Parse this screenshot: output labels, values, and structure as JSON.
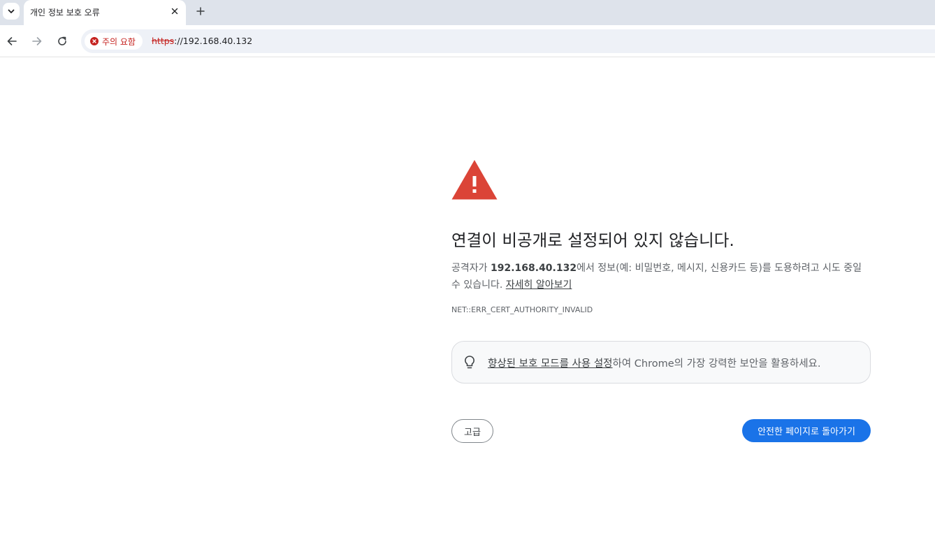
{
  "tab": {
    "title": "개인 정보 보호 오류"
  },
  "toolbar": {
    "security_chip_label": "주의 요함",
    "url_scheme": "https",
    "url_rest": "://192.168.40.132"
  },
  "interstitial": {
    "heading": "연결이 비공개로 설정되어 있지 않습니다.",
    "explanation_prefix": "공격자가 ",
    "host": "192.168.40.132",
    "explanation_suffix": "에서 정보(예: 비밀번호, 메시지, 신용카드 등)를 도용하려고 시도 중일 수 있습니다. ",
    "learn_more_link": "자세히 알아보기",
    "error_code": "NET::ERR_CERT_AUTHORITY_INVALID",
    "promo_link": "향상된 보호 모드를 사용 설정",
    "promo_suffix": "하여 Chrome의 가장 강력한 보안을 활용하세요.",
    "advanced_button": "고급",
    "back_button": "안전한 페이지로 돌아가기"
  },
  "colors": {
    "warning_red": "#db4437",
    "primary_blue": "#1a73e8",
    "danger_text": "#c5221f"
  },
  "icons": {
    "tab_search": "chevron-down-icon",
    "tab_close": "close-icon",
    "new_tab": "plus-icon",
    "back": "arrow-left-icon",
    "forward": "arrow-right-icon",
    "reload": "reload-icon",
    "security": "error-circle-icon",
    "warning": "warning-triangle-icon",
    "promo": "lightbulb-icon"
  }
}
